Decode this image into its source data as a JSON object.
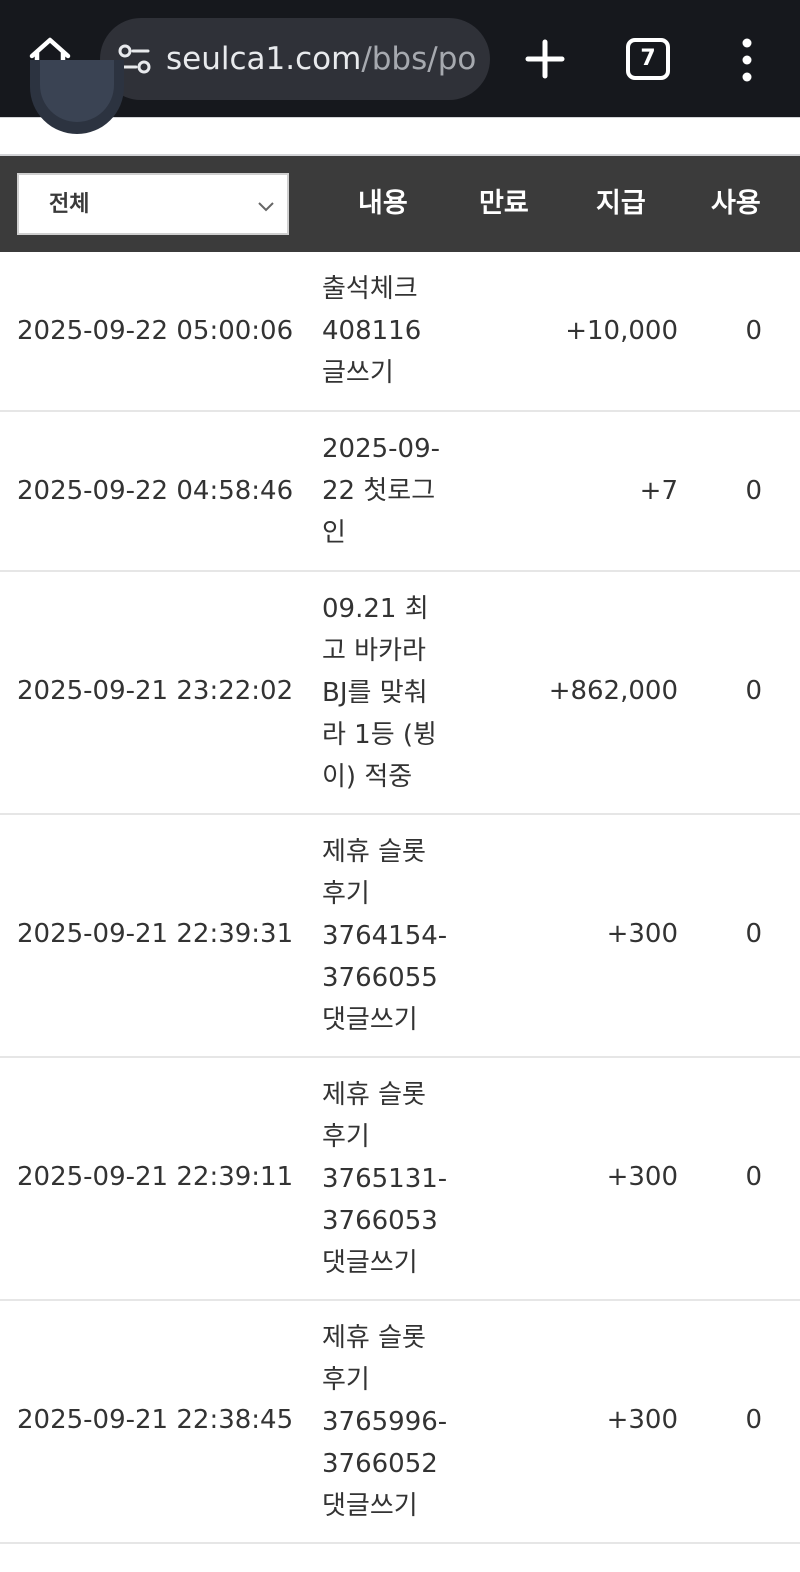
{
  "browser": {
    "url_domain": "seulca1.com",
    "url_path": "/bbs/poi",
    "tab_count": "7"
  },
  "table": {
    "filter_selected": "전체",
    "headers": {
      "content": "내용",
      "expire": "만료",
      "given": "지급",
      "used": "사용"
    },
    "rows": [
      {
        "date": "2025-09-22 05:00:06",
        "content": [
          "출석체크",
          "408116",
          "글쓰기"
        ],
        "given": "+10,000",
        "used": "0"
      },
      {
        "date": "2025-09-22 04:58:46",
        "content": [
          "2025-09-",
          "22 첫로그",
          "인"
        ],
        "given": "+7",
        "used": "0"
      },
      {
        "date": "2025-09-21 23:22:02",
        "content": [
          "09.21 최",
          "고 바카라",
          "BJ를 맞춰",
          "라 1등 (뷩",
          "이) 적중"
        ],
        "given": "+862,000",
        "used": "0"
      },
      {
        "date": "2025-09-21 22:39:31",
        "content": [
          "제휴 슬롯",
          "후기",
          "3764154-",
          "3766055",
          "댓글쓰기"
        ],
        "given": "+300",
        "used": "0"
      },
      {
        "date": "2025-09-21 22:39:11",
        "content": [
          "제휴 슬롯",
          "후기",
          "3765131-",
          "3766053",
          "댓글쓰기"
        ],
        "given": "+300",
        "used": "0"
      },
      {
        "date": "2025-09-21 22:38:45",
        "content": [
          "제휴 슬롯",
          "후기",
          "3765996-",
          "3766052",
          "댓글쓰기"
        ],
        "given": "+300",
        "used": "0"
      }
    ]
  },
  "colors": {
    "topbar": "#16181d",
    "urlbar": "#2f3138",
    "table_header": "#3b3b3b"
  },
  "icons": [
    "home-icon",
    "site-settings-icon",
    "plus-icon",
    "kebab-menu-icon",
    "chevron-down-icon"
  ]
}
